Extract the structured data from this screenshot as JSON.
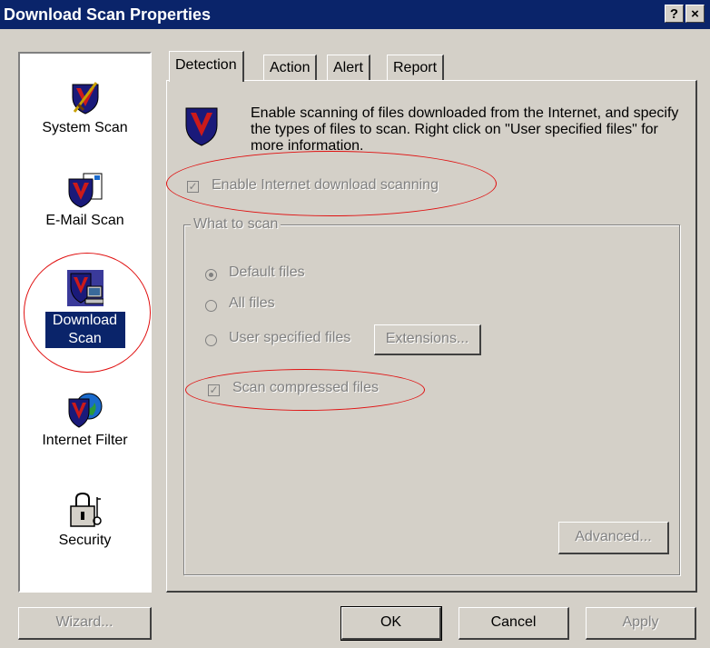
{
  "window": {
    "title": "Download Scan Properties",
    "help_label": "?",
    "close_label": "×"
  },
  "sidebar": {
    "items": [
      {
        "label": "System Scan",
        "icon": "shield-sword-icon"
      },
      {
        "label": "E-Mail Scan",
        "icon": "shield-mail-icon"
      },
      {
        "label": "Download Scan",
        "icon": "shield-computer-icon",
        "selected": true
      },
      {
        "label": "Internet Filter",
        "icon": "shield-globe-icon"
      },
      {
        "label": "Security",
        "icon": "padlock-key-icon"
      }
    ]
  },
  "tabs": [
    {
      "label": "Detection",
      "active": true
    },
    {
      "label": "Action"
    },
    {
      "label": "Alert"
    },
    {
      "label": "Report"
    }
  ],
  "detection": {
    "description": "Enable scanning of files downloaded from the Internet, and specify the types of files to scan. Right click on \"User specified files\" for more information.",
    "enable_download_label": "Enable Internet download scanning",
    "enable_download_checked": true,
    "what_to_scan_label": "What to scan",
    "radio_default_label": "Default files",
    "radio_all_label": "All files",
    "radio_user_label": "User specified files",
    "selected_option": "Default files",
    "extensions_label": "Extensions...",
    "scan_compressed_label": "Scan compressed files",
    "scan_compressed_checked": true,
    "advanced_label": "Advanced..."
  },
  "footer": {
    "wizard_label": "Wizard...",
    "ok_label": "OK",
    "cancel_label": "Cancel",
    "apply_label": "Apply"
  },
  "colors": {
    "titlebar": "#0a246a",
    "selection": "#0a246a",
    "annotation": "#e01010",
    "shield_red": "#cc1a1a",
    "shield_navy": "#1a1a7a"
  }
}
